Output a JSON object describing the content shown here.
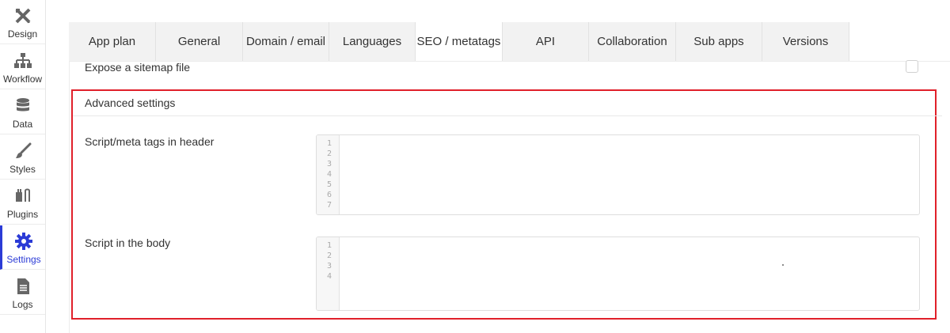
{
  "sidebar": {
    "items": [
      {
        "label": "Design",
        "icon": "design-tools-icon",
        "active": false
      },
      {
        "label": "Workflow",
        "icon": "workflow-icon",
        "active": false
      },
      {
        "label": "Data",
        "icon": "database-icon",
        "active": false
      },
      {
        "label": "Styles",
        "icon": "brush-icon",
        "active": false
      },
      {
        "label": "Plugins",
        "icon": "plug-icon",
        "active": false
      },
      {
        "label": "Settings",
        "icon": "gear-icon",
        "active": true
      },
      {
        "label": "Logs",
        "icon": "document-icon",
        "active": false
      }
    ],
    "active_color": "#2b3bd6"
  },
  "tabs": [
    {
      "label": "App plan"
    },
    {
      "label": "General"
    },
    {
      "label": "Domain / email"
    },
    {
      "label": "Languages"
    },
    {
      "label": "SEO / metatags",
      "active": true
    },
    {
      "label": "API"
    },
    {
      "label": "Collaboration"
    },
    {
      "label": "Sub apps"
    },
    {
      "label": "Versions"
    }
  ],
  "sitemap": {
    "label": "Expose a sitemap file",
    "checked": false
  },
  "advanced": {
    "title": "Advanced settings",
    "header_script": {
      "label": "Script/meta tags in header",
      "line_numbers": [
        "1",
        "2",
        "3",
        "4",
        "5",
        "6",
        "7"
      ],
      "value": ""
    },
    "body_script": {
      "label": "Script in the body",
      "line_numbers": [
        "1",
        "2",
        "3",
        "4"
      ],
      "value": ""
    }
  },
  "highlight_color": "#e0202a"
}
